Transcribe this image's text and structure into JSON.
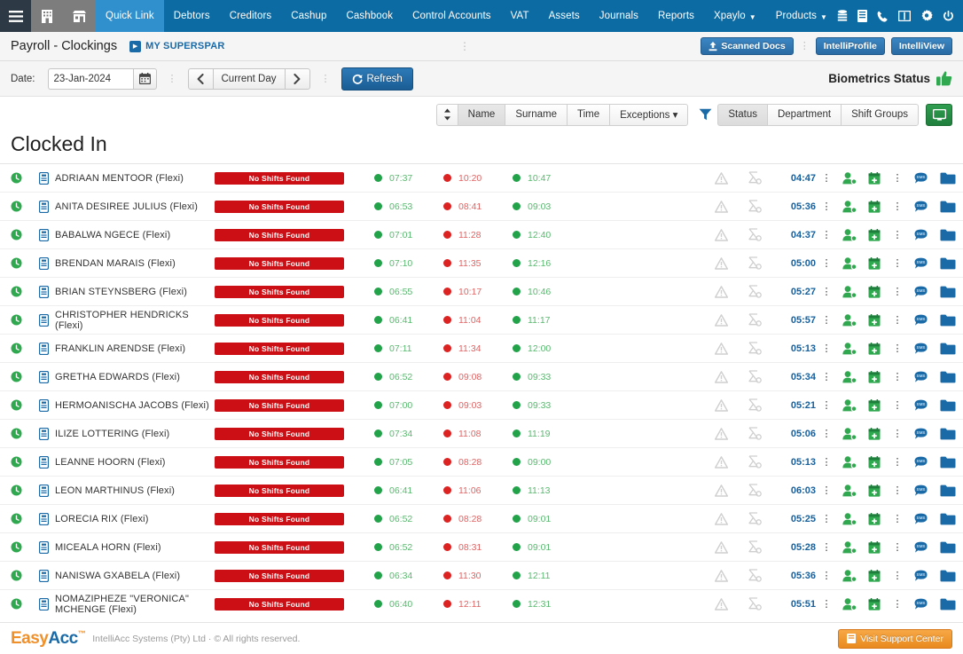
{
  "topnav": {
    "menu_icon": "hamburger-icon",
    "building_icon": "building-icon",
    "store_icon": "store-icon",
    "items": [
      {
        "label": "Quick Link",
        "active": true,
        "caret": false
      },
      {
        "label": "Debtors",
        "active": false,
        "caret": false
      },
      {
        "label": "Creditors",
        "active": false,
        "caret": false
      },
      {
        "label": "Cashup",
        "active": false,
        "caret": false
      },
      {
        "label": "Cashbook",
        "active": false,
        "caret": false
      },
      {
        "label": "Control Accounts",
        "active": false,
        "caret": false
      },
      {
        "label": "VAT",
        "active": false,
        "caret": false
      },
      {
        "label": "Assets",
        "active": false,
        "caret": false
      },
      {
        "label": "Journals",
        "active": false,
        "caret": false
      },
      {
        "label": "Reports",
        "active": false,
        "caret": false
      },
      {
        "label": "Xpaylo",
        "active": false,
        "caret": true
      },
      {
        "label": "Products",
        "active": false,
        "caret": true
      }
    ],
    "right_icons": [
      "database-icon",
      "book-icon",
      "phone-icon",
      "window-icon",
      "gear-icon",
      "power-icon"
    ],
    "bg_color": "#0d6ba3",
    "active_color": "#3090cd"
  },
  "pageheader": {
    "title": "Payroll - Clockings",
    "company": "MY SUPERSPAR",
    "scanned_docs": "Scanned Docs",
    "intelliprofile": "IntelliProfile",
    "intelliview": "IntelliView"
  },
  "toolbar": {
    "date_label": "Date:",
    "date_value": "23-Jan-2024",
    "date_placeholder": "dd-MMM-yyyy",
    "prev_label": "‹",
    "current_day": "Current Day",
    "next_label": "›",
    "refresh": "Refresh",
    "biometrics_label": "Biometrics Status"
  },
  "filterbar": {
    "sort_icon": "sort-updown-icon",
    "sort_buttons": [
      {
        "label": "Name",
        "selected": true
      },
      {
        "label": "Surname",
        "selected": false
      },
      {
        "label": "Time",
        "selected": false
      },
      {
        "label": "Exceptions ▾",
        "selected": false
      }
    ],
    "funnel_icon": "filter-funnel-icon",
    "filter_buttons": [
      {
        "label": "Status",
        "selected": true
      },
      {
        "label": "Department",
        "selected": false
      },
      {
        "label": "Shift Groups",
        "selected": false
      }
    ],
    "screen_button_icon": "monitor-icon",
    "accent_green": "#1f7e3c"
  },
  "section": {
    "title": "Clocked In"
  },
  "table": {
    "no_shifts_label": "No Shifts Found",
    "rows": [
      {
        "name": "ADRIAAN MENTOOR (Flexi)",
        "shift": "No Shifts Found",
        "t1": "07:37",
        "t2": "10:20",
        "t3": "10:47",
        "duration": "04:47"
      },
      {
        "name": "ANITA DESIREE JULIUS (Flexi)",
        "shift": "No Shifts Found",
        "t1": "06:53",
        "t2": "08:41",
        "t3": "09:03",
        "duration": "05:36"
      },
      {
        "name": "BABALWA NGECE (Flexi)",
        "shift": "No Shifts Found",
        "t1": "07:01",
        "t2": "11:28",
        "t3": "12:40",
        "duration": "04:37"
      },
      {
        "name": "BRENDAN MARAIS (Flexi)",
        "shift": "No Shifts Found",
        "t1": "07:10",
        "t2": "11:35",
        "t3": "12:16",
        "duration": "05:00"
      },
      {
        "name": "BRIAN STEYNSBERG (Flexi)",
        "shift": "No Shifts Found",
        "t1": "06:55",
        "t2": "10:17",
        "t3": "10:46",
        "duration": "05:27"
      },
      {
        "name": "CHRISTOPHER HENDRICKS (Flexi)",
        "shift": "No Shifts Found",
        "t1": "06:41",
        "t2": "11:04",
        "t3": "11:17",
        "duration": "05:57"
      },
      {
        "name": "FRANKLIN ARENDSE (Flexi)",
        "shift": "No Shifts Found",
        "t1": "07:11",
        "t2": "11:34",
        "t3": "12:00",
        "duration": "05:13"
      },
      {
        "name": "GRETHA EDWARDS (Flexi)",
        "shift": "No Shifts Found",
        "t1": "06:52",
        "t2": "09:08",
        "t3": "09:33",
        "duration": "05:34"
      },
      {
        "name": "HERMOANISCHA JACOBS (Flexi)",
        "shift": "No Shifts Found",
        "t1": "07:00",
        "t2": "09:03",
        "t3": "09:33",
        "duration": "05:21"
      },
      {
        "name": "ILIZE LOTTERING (Flexi)",
        "shift": "No Shifts Found",
        "t1": "07:34",
        "t2": "11:08",
        "t3": "11:19",
        "duration": "05:06"
      },
      {
        "name": "LEANNE HOORN (Flexi)",
        "shift": "No Shifts Found",
        "t1": "07:05",
        "t2": "08:28",
        "t3": "09:00",
        "duration": "05:13"
      },
      {
        "name": "LEON MARTHINUS (Flexi)",
        "shift": "No Shifts Found",
        "t1": "06:41",
        "t2": "11:06",
        "t3": "11:13",
        "duration": "06:03"
      },
      {
        "name": "LORECIA RIX (Flexi)",
        "shift": "No Shifts Found",
        "t1": "06:52",
        "t2": "08:28",
        "t3": "09:01",
        "duration": "05:25"
      },
      {
        "name": "MICEALA HORN (Flexi)",
        "shift": "No Shifts Found",
        "t1": "06:52",
        "t2": "08:31",
        "t3": "09:01",
        "duration": "05:28"
      },
      {
        "name": "NANISWA GXABELA (Flexi)",
        "shift": "No Shifts Found",
        "t1": "06:34",
        "t2": "11:30",
        "t3": "12:11",
        "duration": "05:36"
      },
      {
        "name": "NOMAZIPHEZE \"VERONICA\" MCHENGE (Flexi)",
        "shift": "No Shifts Found",
        "t1": "06:40",
        "t2": "12:11",
        "t3": "12:31",
        "duration": "05:51"
      }
    ]
  },
  "footer": {
    "brand_part1": "Easy",
    "brand_part2": "Acc",
    "copyright": "IntelliAcc Systems (Pty) Ltd · © All rights reserved.",
    "support_button": "Visit Support Center"
  }
}
